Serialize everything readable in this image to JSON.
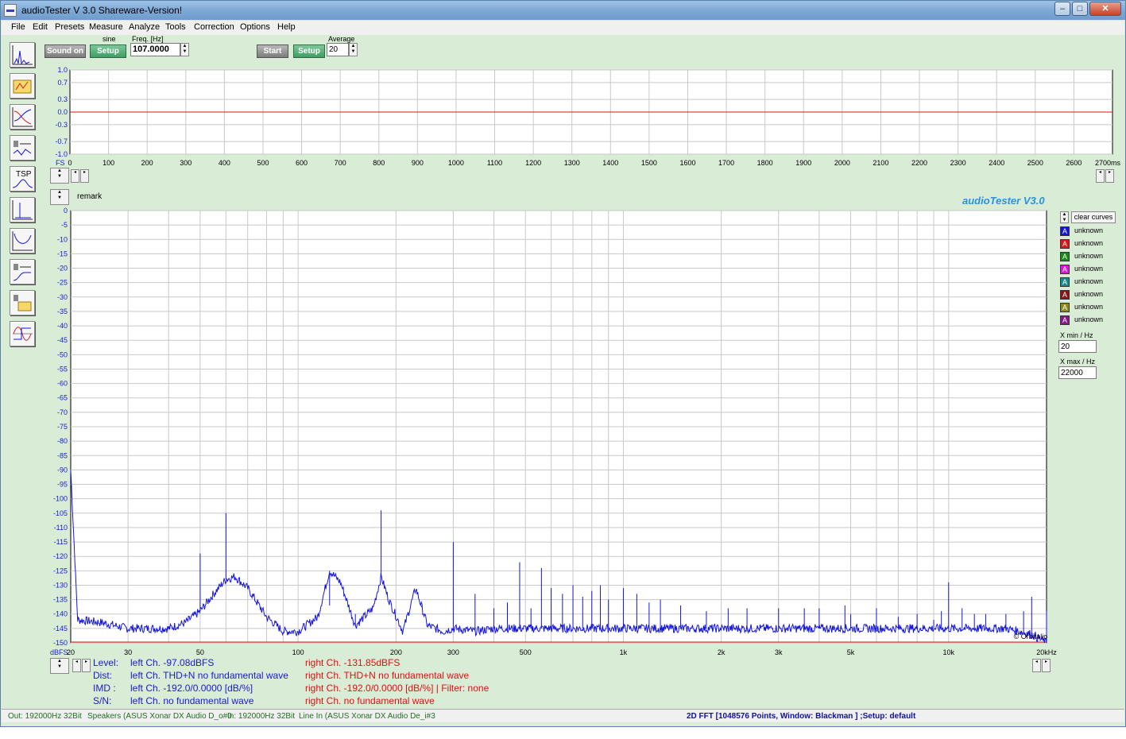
{
  "window": {
    "title": "audioTester  V 3.0 Shareware-Version!"
  },
  "menu": {
    "file": "File",
    "edit": "Edit",
    "presets": "Presets",
    "measure": "Measure",
    "analyze": "Analyze",
    "tools": "Tools",
    "correction": "Correction",
    "options": "Options",
    "help": "Help"
  },
  "generator": {
    "sound_label": "Sound on",
    "waveform": "sine",
    "setup_label": "Setup",
    "freq_label": "Freq. [Hz]",
    "freq_value": "107.0000"
  },
  "analyzer": {
    "start_label": "Start",
    "setup_label": "Setup",
    "average_label": "Average",
    "average_value": "20"
  },
  "scope": {
    "y_labels": [
      "1.0",
      "0.7",
      "0.3",
      "0.0",
      "-0.3",
      "-0.7",
      "-1.0"
    ],
    "x_labels": [
      "0",
      "100",
      "200",
      "300",
      "400",
      "500",
      "600",
      "700",
      "800",
      "900",
      "1000",
      "1100",
      "1200",
      "1300",
      "1400",
      "1500",
      "1600",
      "1700",
      "1800",
      "1900",
      "2000",
      "2100",
      "2200",
      "2300",
      "2400",
      "2500",
      "2600",
      "2700ms"
    ],
    "fs_label": "FS"
  },
  "spectrum": {
    "remark": "remark",
    "brand": "audioTester  V3.0",
    "y_unit": "dBFS",
    "watermark": "© Orbitalio",
    "clear_label": "clear curves"
  },
  "legend": [
    {
      "label": "unknown",
      "color": "#1414e0"
    },
    {
      "label": "unknown",
      "color": "#e01414"
    },
    {
      "label": "unknown",
      "color": "#148c14"
    },
    {
      "label": "unknown",
      "color": "#e014e0"
    },
    {
      "label": "unknown",
      "color": "#148c8c"
    },
    {
      "label": "unknown",
      "color": "#8c1414"
    },
    {
      "label": "unknown",
      "color": "#8c8c14"
    },
    {
      "label": "unknown",
      "color": "#8c148c"
    }
  ],
  "range": {
    "xmin_label": "X min / Hz",
    "xmin_value": "20",
    "xmax_label": "X max / Hz",
    "xmax_value": "22000"
  },
  "info": {
    "level_label": "Level:",
    "level_left": "left Ch. -97.08dBFS",
    "level_right": "right Ch. -131.85dBFS",
    "dist_label": "Dist:",
    "dist_left": "left Ch. THD+N  no fundamental wave",
    "dist_right": "right Ch. THD+N  no fundamental wave",
    "imd_label": "IMD  :",
    "imd_left": "left Ch. -192.0/0.0000 [dB/%]",
    "imd_right": "right Ch. -192.0/0.0000 [dB/%] |   Filter: none",
    "sn_label": "S/N:",
    "sn_left": "left Ch.  no fundamental wave",
    "sn_right": "right Ch.  no fundamental wave"
  },
  "status": {
    "out": "Out: 192000Hz 32Bit",
    "out_dev": "Speakers (ASUS Xonar DX Audio D_o#0",
    "in": "In: 192000Hz 32Bit",
    "in_dev": "Line In (ASUS Xonar DX Audio De_i#3",
    "mode": "2D FFT [1048576 Points, Window: Blackman ]  ;Setup:  default"
  },
  "chart_data": [
    {
      "type": "line",
      "title": "",
      "xlabel": "ms",
      "ylabel": "",
      "xlim": [
        0,
        2700
      ],
      "ylim": [
        -1.0,
        1.0
      ],
      "grid": true,
      "series": [
        {
          "color": "#e01010",
          "x": [
            0,
            2700
          ],
          "y": [
            0.0,
            0.0
          ]
        }
      ]
    },
    {
      "type": "line",
      "title": "",
      "xlabel": "",
      "ylabel": "dBFS",
      "xscale": "log",
      "xlim": [
        20,
        20000
      ],
      "ylim": [
        -150,
        0
      ],
      "grid": true,
      "x_ticks": [
        20,
        30,
        50,
        100,
        200,
        300,
        500,
        1000,
        2000,
        3000,
        5000,
        10000,
        20000
      ],
      "x_tick_labels": [
        "20",
        "30",
        "50",
        "100",
        "200",
        "300",
        "500",
        "1k",
        "2k",
        "3k",
        "5k",
        "10k",
        "20kHz"
      ],
      "y_ticks": [
        0,
        -5,
        -10,
        -15,
        -20,
        -25,
        -30,
        -35,
        -40,
        -45,
        -50,
        -55,
        -60,
        -65,
        -70,
        -75,
        -80,
        -85,
        -90,
        -95,
        -100,
        -105,
        -110,
        -115,
        -120,
        -125,
        -130,
        -135,
        -140,
        -145,
        -150
      ],
      "series": [
        {
          "color": "#1414e0",
          "baseline_x": [
            20,
            21,
            25,
            30,
            35,
            40,
            45,
            50,
            55,
            60,
            64,
            70,
            80,
            90,
            100,
            115,
            125,
            135,
            150,
            170,
            180,
            190,
            210,
            230,
            250,
            280,
            300,
            350,
            400,
            500,
            700,
            1000,
            2000,
            5000,
            10000,
            15000,
            18000,
            20000
          ],
          "baseline_y": [
            -90,
            -142,
            -143,
            -145,
            -145,
            -145,
            -143,
            -139,
            -133,
            -128,
            -127,
            -131,
            -141,
            -146,
            -146,
            -141,
            -125,
            -129,
            -144,
            -138,
            -127,
            -135,
            -146,
            -131,
            -144,
            -146,
            -145,
            -146,
            -145,
            -145,
            -145,
            -145,
            -145,
            -145,
            -145,
            -145,
            -147,
            -150
          ],
          "peaks_x": [
            50,
            60,
            125,
            150,
            180,
            240,
            300,
            350,
            400,
            440,
            480,
            520,
            560,
            600,
            650,
            700,
            750,
            800,
            850,
            900,
            1000,
            1100,
            1200,
            1300,
            1500,
            1800,
            2100,
            2400,
            3000,
            3600,
            4000,
            4800,
            5000,
            6000,
            7000,
            8000,
            9000,
            9500,
            10000,
            11000,
            12000,
            13000,
            15000,
            17000,
            18000,
            20000
          ],
          "peaks_y": [
            -119,
            -105,
            -137,
            -140,
            -104,
            -137,
            -115,
            -133,
            -138,
            -136,
            -122,
            -138,
            -124,
            -131,
            -133,
            -130,
            -134,
            -132,
            -130,
            -135,
            -131,
            -133,
            -136,
            -135,
            -137,
            -139,
            -138,
            -138,
            -138,
            -138,
            -138,
            -137,
            -140,
            -138,
            -141,
            -140,
            -142,
            -139,
            -129,
            -138,
            -140,
            -140,
            -140,
            -139,
            -134,
            -139
          ]
        }
      ]
    }
  ]
}
